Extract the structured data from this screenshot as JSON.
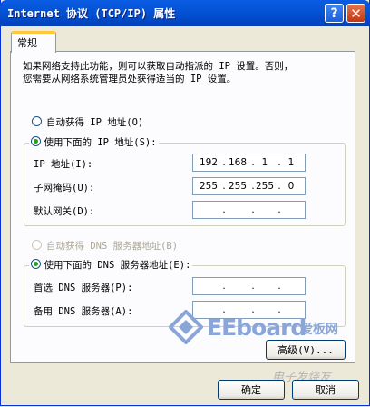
{
  "window": {
    "title": "Internet 协议 (TCP/IP) 属性"
  },
  "title_buttons": {
    "help": "?",
    "close": "✕"
  },
  "tabs": [
    {
      "label": "常规"
    }
  ],
  "description": [
    "如果网络支持此功能，则可以获取自动指派的 IP 设置。否则，",
    "您需要从网络系统管理员处获得适当的 IP 设置。"
  ],
  "ip": {
    "auto_label": "自动获得 IP 地址(O)",
    "manual_label": "使用下面的 IP 地址(S):",
    "fields": [
      {
        "label": "IP 地址(I):",
        "octets": [
          "192",
          "168",
          "1",
          "1"
        ]
      },
      {
        "label": "子网掩码(U):",
        "octets": [
          "255",
          "255",
          "255",
          "0"
        ]
      },
      {
        "label": "默认网关(D):",
        "octets": [
          "",
          "",
          "",
          ""
        ]
      }
    ]
  },
  "dns": {
    "auto_label": "自动获得 DNS 服务器地址(B)",
    "manual_label": "使用下面的 DNS 服务器地址(E):",
    "fields": [
      {
        "label": "首选 DNS 服务器(P):",
        "octets": [
          "",
          "",
          "",
          ""
        ]
      },
      {
        "label": "备用 DNS 服务器(A):",
        "octets": [
          "",
          "",
          "",
          ""
        ]
      }
    ]
  },
  "buttons": {
    "advanced": "高级(V)...",
    "ok": "确定",
    "cancel": "取消"
  },
  "watermark": {
    "logo_text": "EEboard",
    "logo_cn": "爱板网",
    "secondary": "电子发烧友"
  },
  "colors": {
    "titlebar": "#0454d6",
    "radio_dot": "#21a121",
    "tab_accent": "#ffc83c"
  }
}
